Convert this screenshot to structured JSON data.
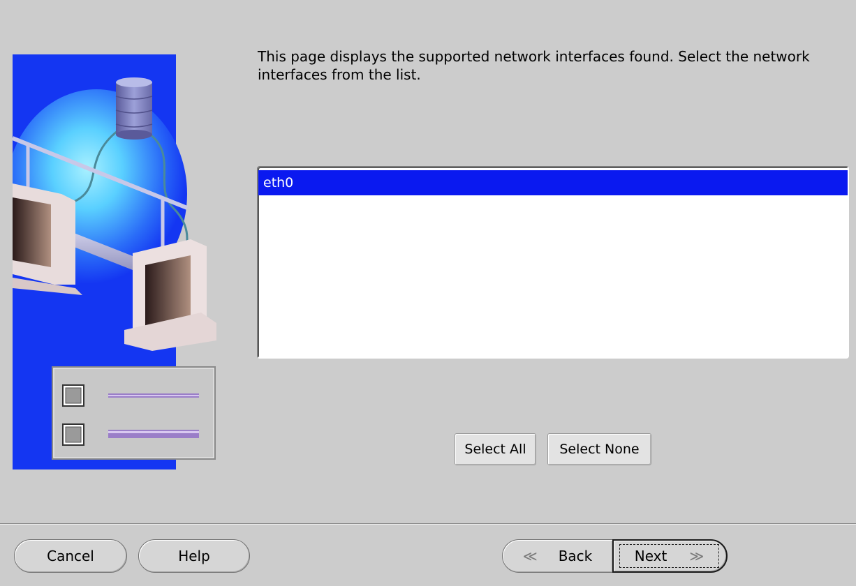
{
  "instructions": {
    "text": "This page displays the supported network interfaces found. Select the network interfaces from the list."
  },
  "interfaces": {
    "items": [
      "eth0"
    ],
    "selected": "eth0"
  },
  "selection_buttons": {
    "select_all": "Select All",
    "select_none": "Select None"
  },
  "footer": {
    "cancel": "Cancel",
    "help": "Help",
    "back": "Back",
    "next": "Next"
  },
  "icons": {
    "back": "chevron-left-double-icon",
    "next": "chevron-right-double-icon"
  },
  "colors": {
    "background": "#cccccc",
    "selection": "#0a19f0",
    "illustration_blue": "#1a3cf5"
  }
}
